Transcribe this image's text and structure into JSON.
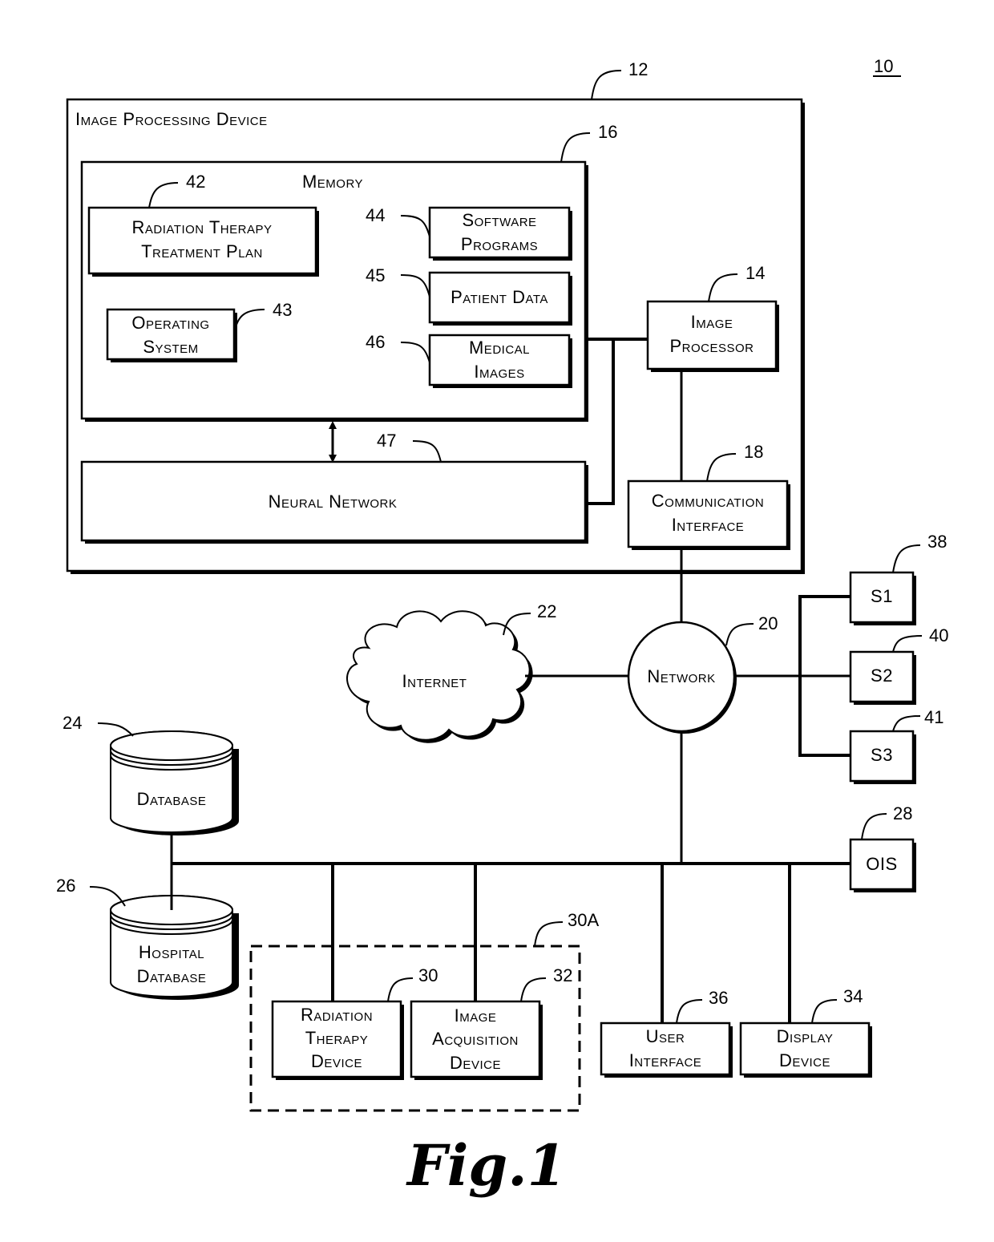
{
  "figure": {
    "system_ref": "10",
    "caption": "Fig.1"
  },
  "image_processing_device": {
    "label": "Image Processing Device",
    "ref": "12"
  },
  "memory": {
    "label": "Memory",
    "ref": "16"
  },
  "treatment_plan": {
    "line1": "Radiation Therapy",
    "line2": "Treatment Plan",
    "ref": "42"
  },
  "operating_system": {
    "line1": "Operating",
    "line2": "System",
    "ref": "43"
  },
  "software_programs": {
    "line1": "Software",
    "line2": "Programs",
    "ref": "44"
  },
  "patient_data": {
    "label": "Patient Data",
    "ref": "45"
  },
  "medical_images": {
    "line1": "Medical",
    "line2": "Images",
    "ref": "46"
  },
  "neural_network": {
    "label": "Neural Network",
    "ref": "47"
  },
  "image_processor": {
    "line1": "Image",
    "line2": "Processor",
    "ref": "14"
  },
  "communication_interface": {
    "line1": "Communication",
    "line2": "Interface",
    "ref": "18"
  },
  "network": {
    "label": "Network",
    "ref": "20"
  },
  "internet": {
    "label": "Internet",
    "ref": "22"
  },
  "s1": {
    "label": "S1",
    "ref": "38"
  },
  "s2": {
    "label": "S2",
    "ref": "40"
  },
  "s3": {
    "label": "S3",
    "ref": "41"
  },
  "database": {
    "label": "Database",
    "ref": "24"
  },
  "hospital_database": {
    "line1": "Hospital",
    "line2": "Database",
    "ref": "26"
  },
  "ois": {
    "label": "OIS",
    "ref": "28"
  },
  "treatment_group": {
    "ref": "30A"
  },
  "radiation_therapy_device": {
    "line1": "Radiation",
    "line2": "Therapy",
    "line3": "Device",
    "ref": "30"
  },
  "image_acquisition_device": {
    "line1": "Image",
    "line2": "Acquisition",
    "line3": "Device",
    "ref": "32"
  },
  "user_interface": {
    "line1": "User",
    "line2": "Interface",
    "ref": "36"
  },
  "display_device": {
    "line1": "Display",
    "line2": "Device",
    "ref": "34"
  }
}
